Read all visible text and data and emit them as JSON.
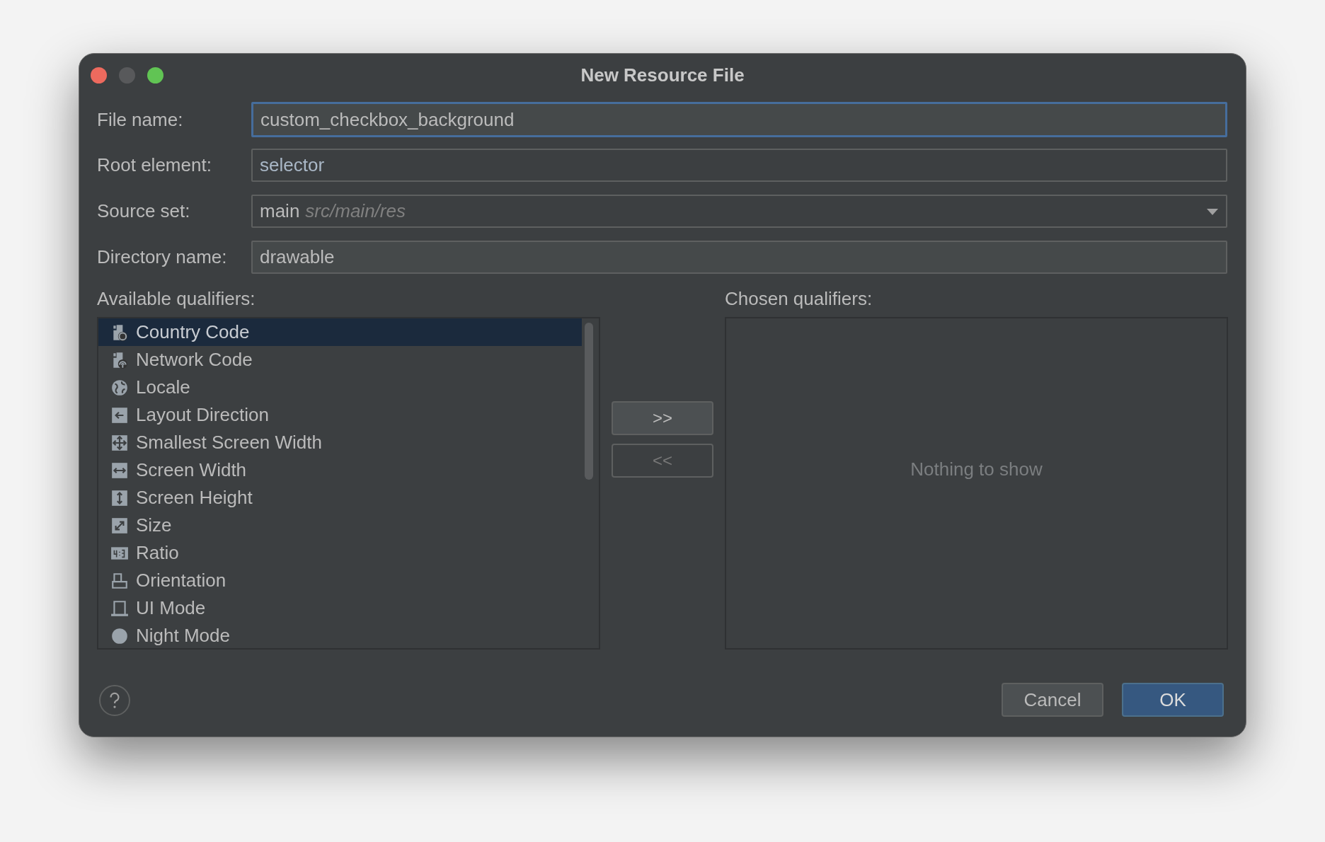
{
  "window": {
    "title": "New Resource File"
  },
  "form": [
    {
      "kind": "text",
      "label": "File name:",
      "value": "custom_checkbox_background",
      "focused": true
    },
    {
      "kind": "completion",
      "label": "Root element:",
      "value": "selector",
      "focused": false
    },
    {
      "kind": "dropdown",
      "label": "Source set:",
      "value": "main",
      "hint": "src/main/res",
      "focused": false
    },
    {
      "kind": "text",
      "label": "Directory name:",
      "value": "drawable",
      "focused": false
    }
  ],
  "available": {
    "label": "Available qualifiers:",
    "items": [
      {
        "label": "Country Code",
        "selected": true
      },
      {
        "label": "Network Code",
        "selected": false
      },
      {
        "label": "Locale",
        "selected": false
      },
      {
        "label": "Layout Direction",
        "selected": false
      },
      {
        "label": "Smallest Screen Width",
        "selected": false
      },
      {
        "label": "Screen Width",
        "selected": false
      },
      {
        "label": "Screen Height",
        "selected": false
      },
      {
        "label": "Size",
        "selected": false
      },
      {
        "label": "Ratio",
        "selected": false
      },
      {
        "label": "Orientation",
        "selected": false
      },
      {
        "label": "UI Mode",
        "selected": false
      },
      {
        "label": "Night Mode",
        "selected": false
      }
    ]
  },
  "move_buttons": [
    {
      "label": ">>",
      "disabled": false
    },
    {
      "label": "<<",
      "disabled": true
    }
  ],
  "chosen": {
    "label": "Chosen qualifiers:",
    "empty_text": "Nothing to show"
  },
  "buttons": [
    {
      "label": "Cancel",
      "default": false
    },
    {
      "label": "OK",
      "default": true
    }
  ]
}
